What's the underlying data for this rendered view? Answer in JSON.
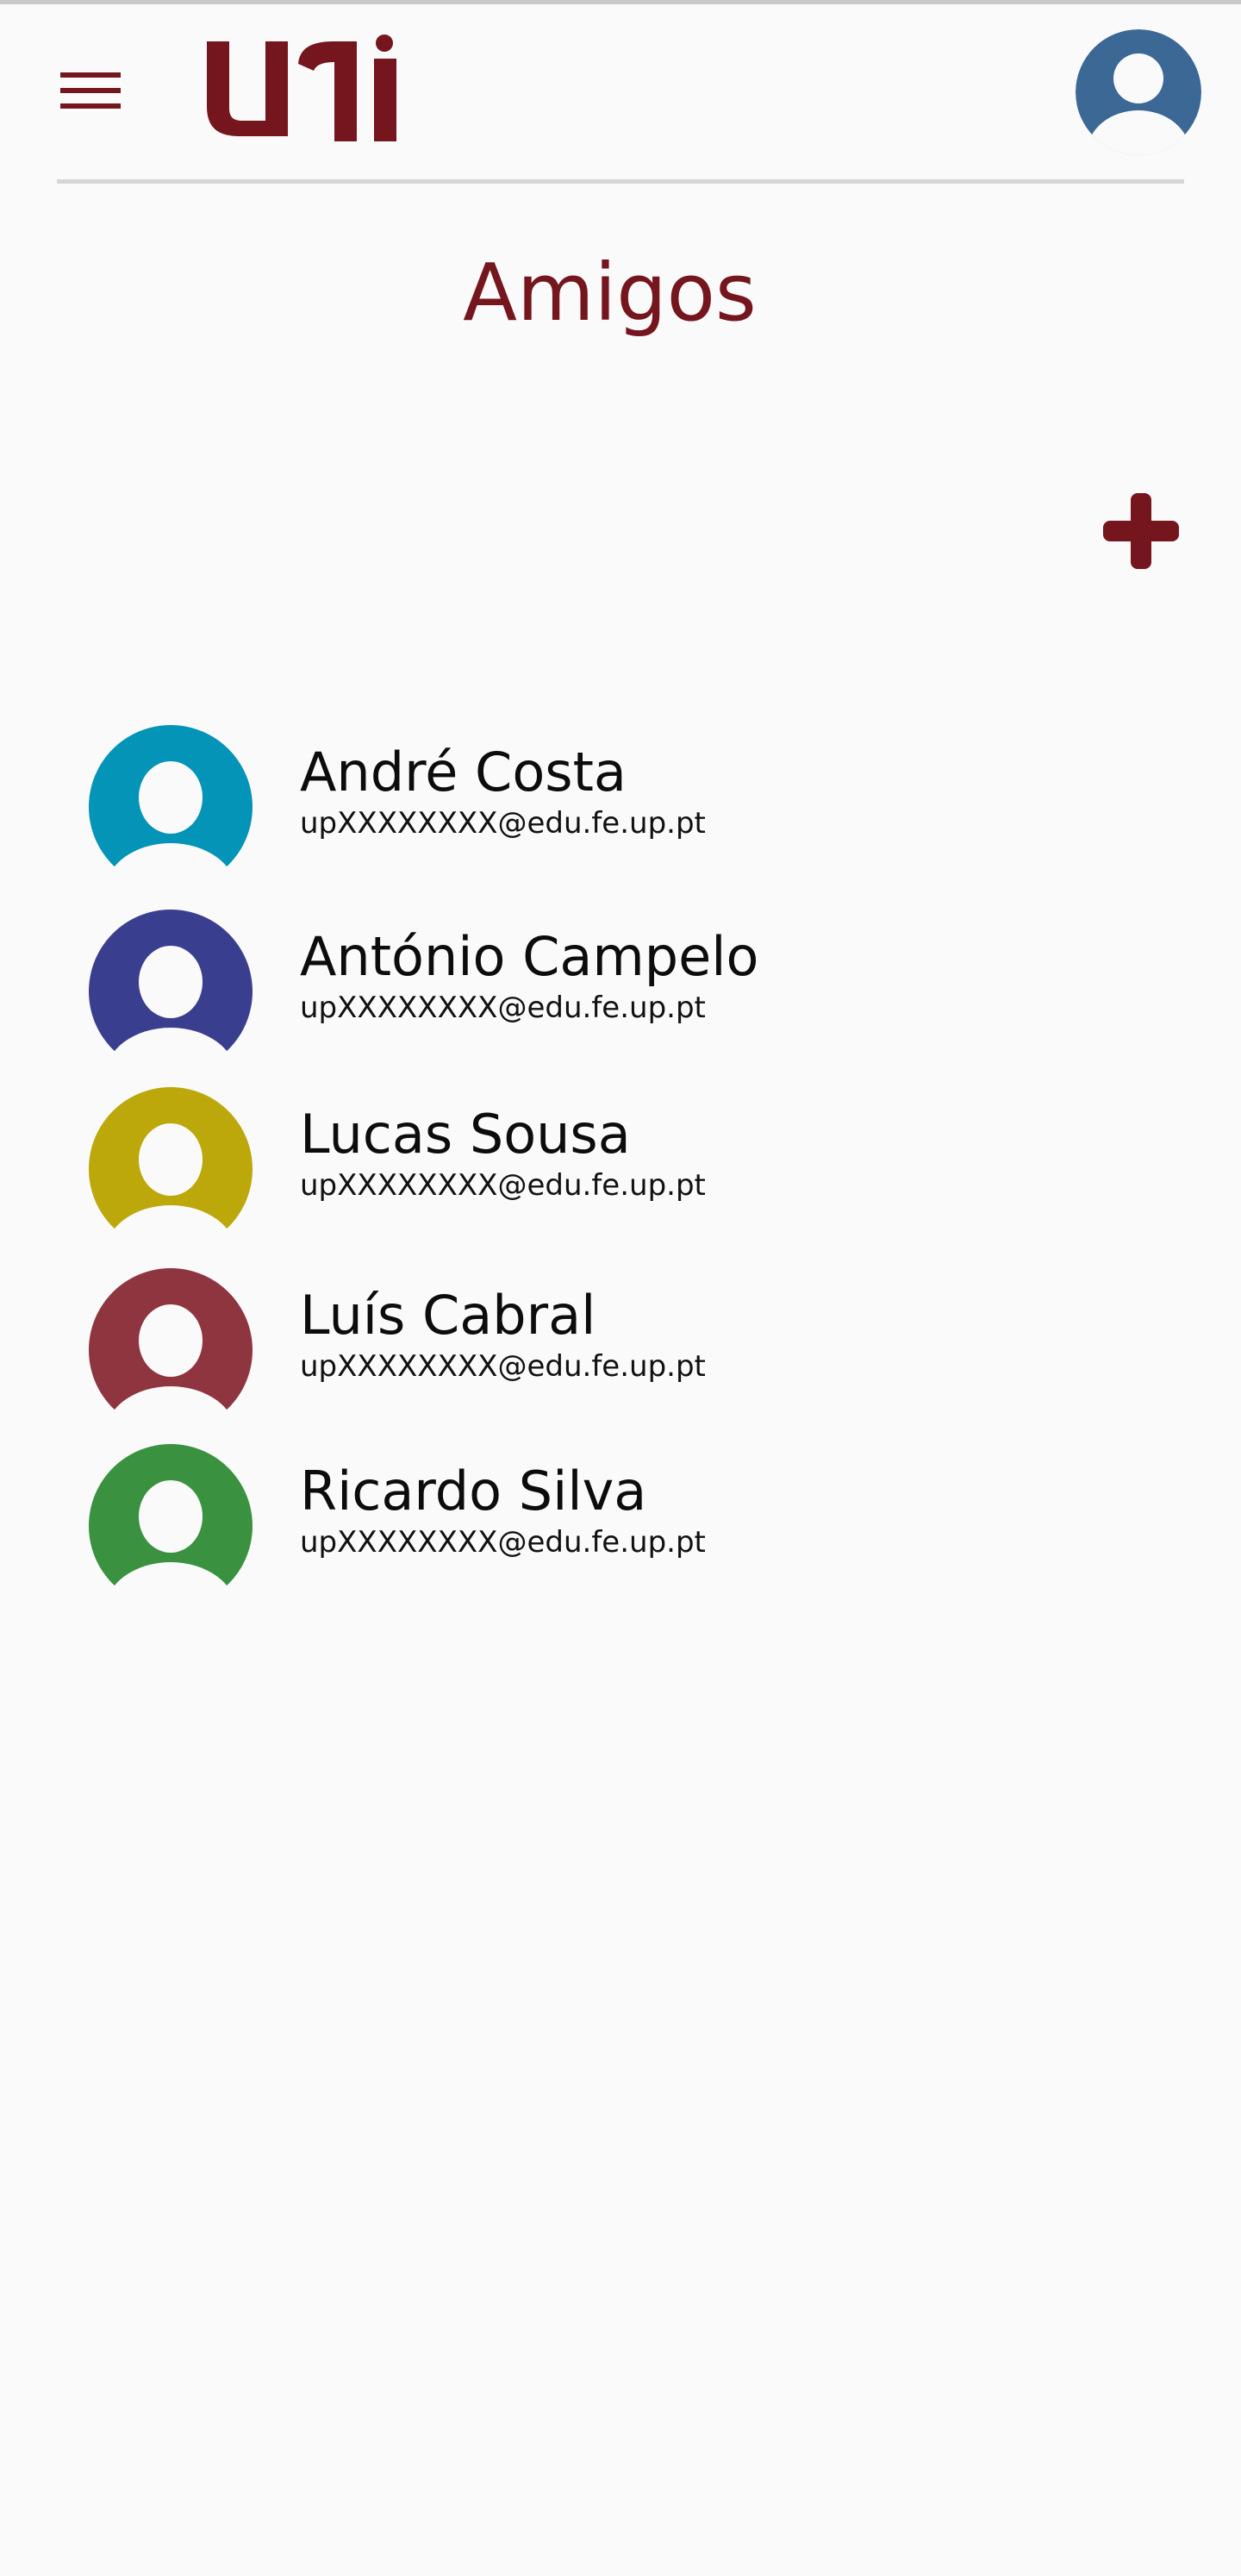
{
  "app": {
    "logo_text": "uni",
    "brand_color": "#75161e",
    "menu_icon": "hamburger-menu-icon",
    "profile_icon": "user-avatar-icon",
    "profile_avatar_color": "#3b6895"
  },
  "page": {
    "title": "Amigos",
    "add_icon": "plus-icon"
  },
  "friends": [
    {
      "name": "André Costa",
      "email": "upXXXXXXXX@edu.fe.up.pt",
      "avatar_color": "#0394b8"
    },
    {
      "name": "António Campelo",
      "email": "upXXXXXXXX@edu.fe.up.pt",
      "avatar_color": "#3a3e8f"
    },
    {
      "name": "Lucas Sousa",
      "email": "upXXXXXXXX@edu.fe.up.pt",
      "avatar_color": "#bda80b"
    },
    {
      "name": "Luís Cabral",
      "email": "upXXXXXXXX@edu.fe.up.pt",
      "avatar_color": "#8f353f"
    },
    {
      "name": "Ricardo Silva",
      "email": "upXXXXXXXX@edu.fe.up.pt",
      "avatar_color": "#3a9241"
    }
  ]
}
